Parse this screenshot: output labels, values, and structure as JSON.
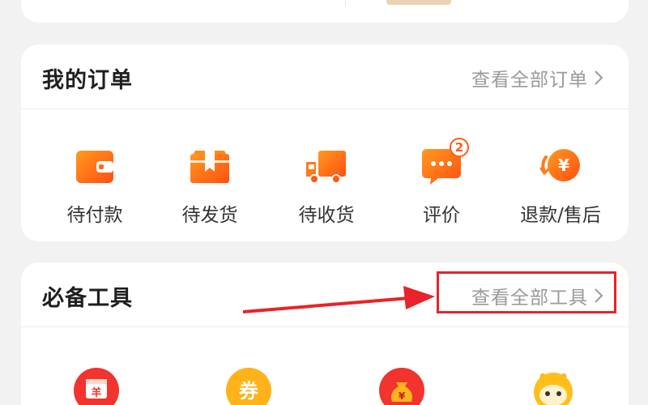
{
  "orders": {
    "title": "我的订单",
    "view_all": "查看全部订单",
    "items": [
      {
        "label": "待付款",
        "icon": "wallet-icon"
      },
      {
        "label": "待发货",
        "icon": "package-box-icon"
      },
      {
        "label": "待收货",
        "icon": "delivery-truck-icon"
      },
      {
        "label": "评价",
        "icon": "chat-bubble-icon",
        "badge": "2"
      },
      {
        "label": "退款/售后",
        "icon": "refund-yuan-icon"
      }
    ]
  },
  "tools": {
    "title": "必备工具",
    "view_all": "查看全部工具",
    "items": [
      {
        "icon": "calendar-yuan-icon",
        "glyph": "羊"
      },
      {
        "icon": "coupon-icon",
        "glyph": "券"
      },
      {
        "icon": "money-bag-icon",
        "glyph": "¥"
      },
      {
        "icon": "mascot-icon"
      }
    ]
  },
  "colors": {
    "accent": "#ff6a00",
    "highlight": "#e8232a",
    "muted_text": "#9a9a9a"
  }
}
